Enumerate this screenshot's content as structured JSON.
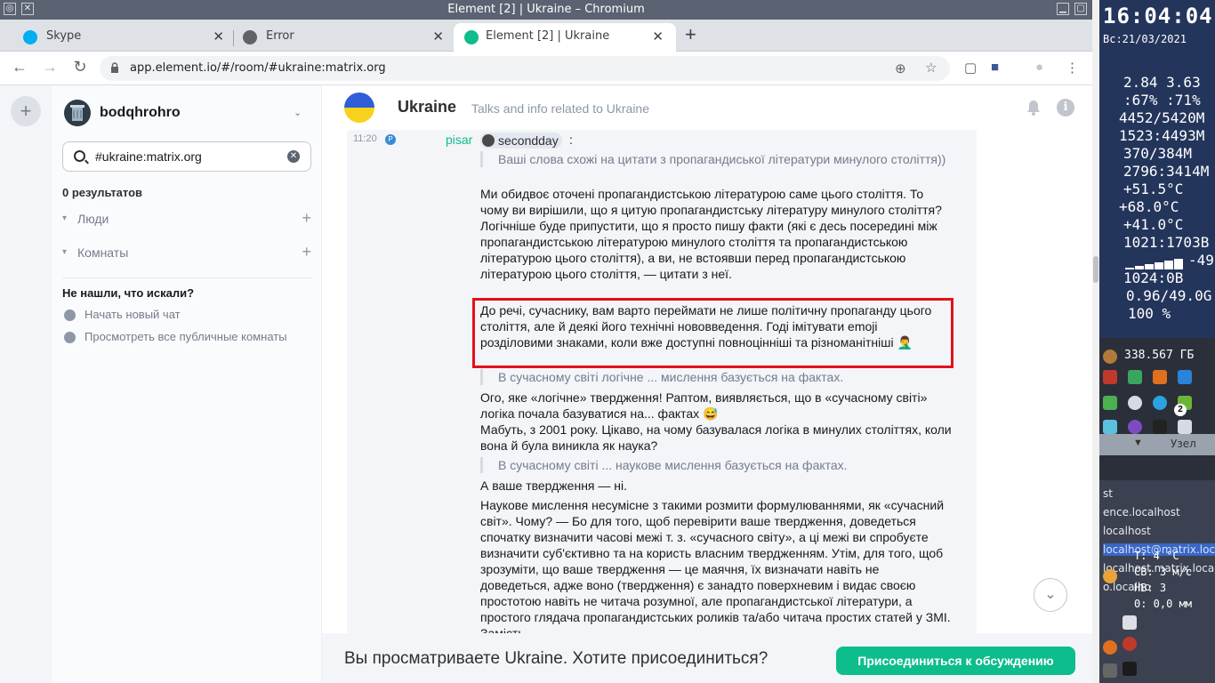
{
  "window": {
    "title": "Element [2] | Ukraine – Chromium",
    "tabs": [
      {
        "label": "Skype"
      },
      {
        "label": "Error"
      },
      {
        "label": "Element [2] | Ukraine"
      }
    ],
    "url": "app.element.io/#/room/#ukraine:matrix.org"
  },
  "sidebar": {
    "user_name": "bodqhrohro",
    "search_value": "#ukraine:matrix.org",
    "results_count": "0 результатов",
    "sections": [
      {
        "label": "Люди"
      },
      {
        "label": "Комнаты"
      }
    ],
    "not_found_title": "Не нашли, что искали?",
    "hints": [
      {
        "label": "Начать новый чат"
      },
      {
        "label": "Просмотреть все публичные комнаты"
      }
    ]
  },
  "room": {
    "name": "Ukraine",
    "topic": "Talks and info related to Ukraine"
  },
  "message": {
    "time": "11:20",
    "badge": "P",
    "sender": "pisar",
    "mention": "secondday",
    "colon": ":",
    "quote1": "Ваші слова схожі на цитати з пропагандиської літератури минулого століття))",
    "para1": "Ми обидвоє оточені пропагандистською літературою саме цього століття. То чому ви вирішили, що я цитую пропагандистську літературу минулого століття? Логічніше буде припустити, що я просто пишу факти (які є десь посередині між пропагандистською літературою минулого століття та пропагандистською літературою цього століття), а ви, не встоявши перед пропагандистською літературою цього століття, — цитати з неї.",
    "para2": "До речі, сучаснику, вам варто переймати не лише політичну пропаганду цього століття, але й деякі його технічні нововведення. Годі імітувати emoji розділовими знаками, коли вже доступні повноцінніші та різноманітніші 🤦‍♂️",
    "quote2": "В сучасному світі логічне ... мислення базується на фактах.",
    "para3": "Ого, яке «логічне» твердження! Раптом, виявляється, що в «сучасному світі» логіка почала базуватися на... фактах 😅",
    "para4": "Мабуть, з 2001 року. Цікаво, на чому базувалася логіка в минулих століттях, коли вона й була виникла як наука?",
    "quote3": "В сучасному світі ... наукове мислення базується на фактах.",
    "para5": "А ваше твердження — ні.",
    "para6": "Наукове мислення несумісне з такими розмити формулюваннями, як «сучасний світ». Чому? — Бо для того, щоб перевірити ваше твердження, доведеться спочатку визначити часові межі т. з. «сучасного світу», а ці межі ви спробуєте визначити суб'єктивно та на користь власним твердженням. Утім, для того, щоб зрозуміти, що ваше твердження — це маячня, їх визначати навіть не доведеться, адже воно (твердження) є занадто поверхневим і видає своєю простотою навіть не читача розумної, але пропагандистської літератури, а простого глядача пропагандистських роликів та/або читача простих статей у ЗМІ. Замість"
  },
  "join_bar": {
    "text": "Вы просматриваете Ukraine. Хотите присоединиться?",
    "button": "Присоединиться к обсуждению"
  },
  "conky": {
    "time": "16:04:04",
    "date": "Вс:21/03/2021",
    "stats": [
      "2.84 3.63",
      ":67% :71%",
      "4452/5420M",
      "1523:4493M",
      "370/384M",
      "2796:3414M",
      "+51.5°C",
      "+68.0°C",
      "+41.0°C",
      "1021:1703B",
      "-49",
      "1024:0B",
      "0.96/49.0G",
      "100 %"
    ],
    "disk": "338.567 ГБ",
    "notify_count": "2",
    "node": "Узел",
    "hosts": [
      "st",
      "ence.localhost",
      "localhost",
      "localhost@matrix.loca",
      "localhost.matrix.loca",
      "o.localho"
    ],
    "weather": [
      "T: 4 °C",
      "СВ: 3 м/с",
      "НВ: 3",
      "0: 0,0 мм"
    ]
  },
  "colors": {
    "accent": "#0dbd8b",
    "highlight_border": "#e3111b",
    "mention_link": "#368bd6"
  }
}
